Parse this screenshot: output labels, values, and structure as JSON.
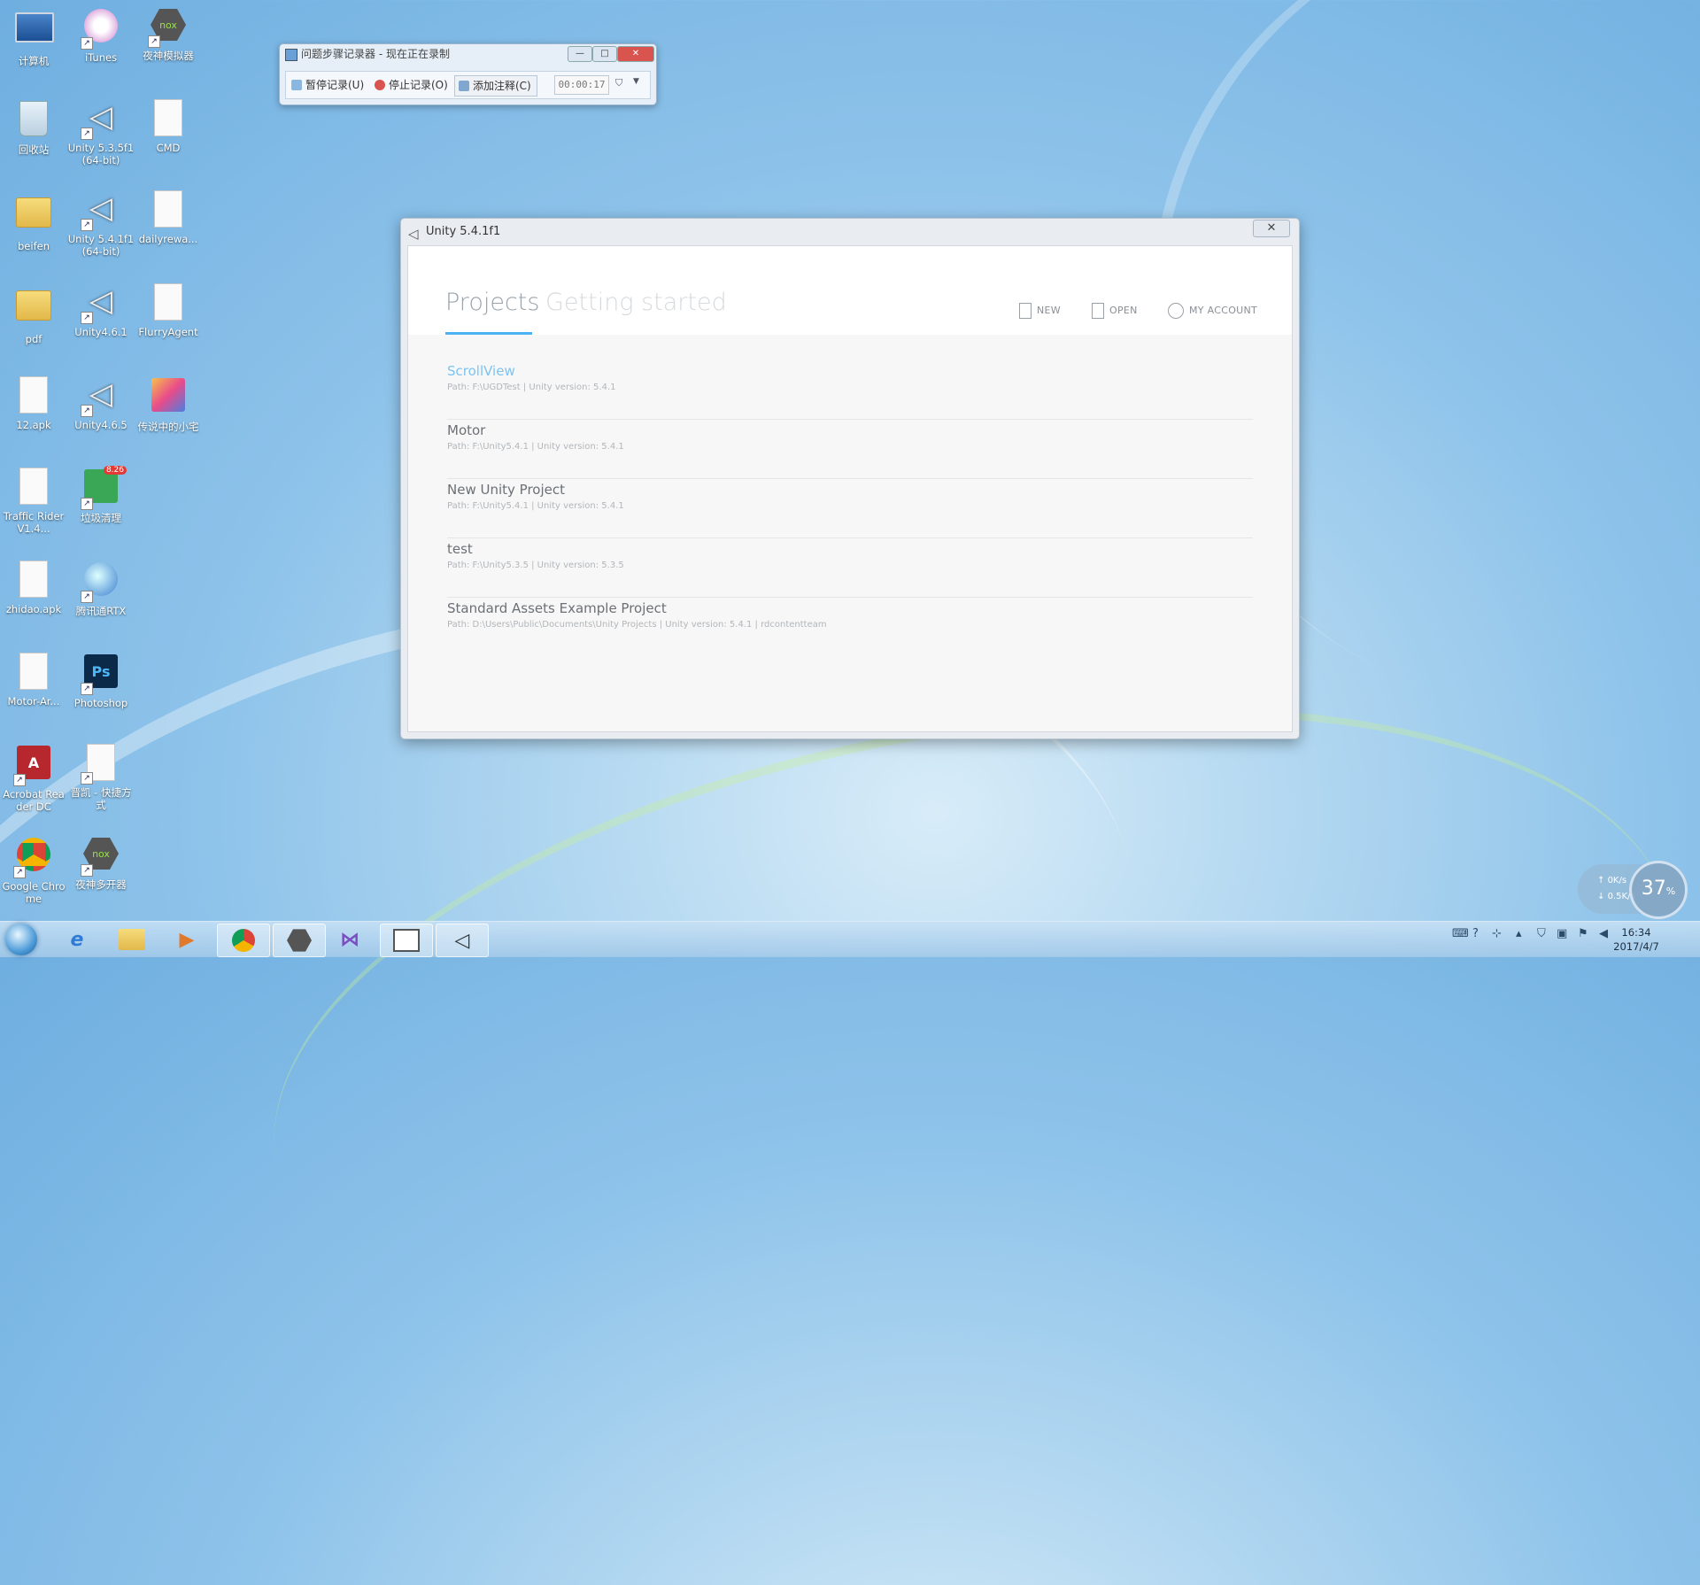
{
  "desktop": {
    "icons": [
      {
        "label": "计算机"
      },
      {
        "label": "iTunes"
      },
      {
        "label": "夜神模拟器"
      },
      {
        "label": "回收站"
      },
      {
        "label": "Unity 5.3.5f1 (64-bit)"
      },
      {
        "label": "CMD"
      },
      {
        "label": "beifen"
      },
      {
        "label": "Unity 5.4.1f1 (64-bit)"
      },
      {
        "label": "dailyrewa..."
      },
      {
        "label": "pdf"
      },
      {
        "label": "Unity4.6.1"
      },
      {
        "label": "FlurryAgent"
      },
      {
        "label": "12.apk"
      },
      {
        "label": "Unity4.6.5"
      },
      {
        "label": "传说中的小宅"
      },
      {
        "label": "Traffic RiderV1.4..."
      },
      {
        "label": "垃圾清理",
        "badge": "8.26"
      },
      {
        "label": "zhidao.apk"
      },
      {
        "label": "腾讯通RTX"
      },
      {
        "label": "Motor-Ar..."
      },
      {
        "label": "Photoshop",
        "glyph_text": "Ps"
      },
      {
        "label": "Acrobat Reader DC"
      },
      {
        "label": "晋凯 - 快捷方式"
      },
      {
        "label": "Google Chrome"
      },
      {
        "label": "夜神多开器"
      }
    ]
  },
  "recorder": {
    "title": "问题步骤记录器 - 现在正在录制",
    "minimize": "—",
    "maximize": "□",
    "close": "✕",
    "pause_label": "暂停记录(U)",
    "stop_label": "停止记录(O)",
    "add_comment_label": "添加注释(C)",
    "timer": "00:00:17"
  },
  "unity": {
    "title": "Unity 5.4.1f1",
    "close": "✕",
    "tabs": {
      "projects": "Projects",
      "getting_started": "Getting started"
    },
    "actions": {
      "new": "NEW",
      "open": "OPEN",
      "account": "MY ACCOUNT"
    },
    "projects": [
      {
        "name": "ScrollView",
        "path": "Path: F:\\UGDTest | Unity version: 5.4.1"
      },
      {
        "name": "Motor",
        "path": "Path: F:\\Unity5.4.1 | Unity version: 5.4.1"
      },
      {
        "name": "New Unity Project",
        "path": "Path: F:\\Unity5.4.1 | Unity version: 5.4.1"
      },
      {
        "name": "test",
        "path": "Path: F:\\Unity5.3.5 | Unity version: 5.3.5"
      },
      {
        "name": "Standard Assets Example Project",
        "path": "Path: D:\\Users\\Public\\Documents\\Unity Projects | Unity version: 5.4.1 | rdcontentteam"
      }
    ]
  },
  "network_widget": {
    "up": "0K/s",
    "down": "0.5K/s",
    "percent": "37",
    "percent_unit": "%"
  },
  "taskbar": {
    "time": "16:34",
    "date": "2017/4/7"
  },
  "colors": {
    "accent": "#4db2f4",
    "active_project": "#7ec3f0"
  }
}
